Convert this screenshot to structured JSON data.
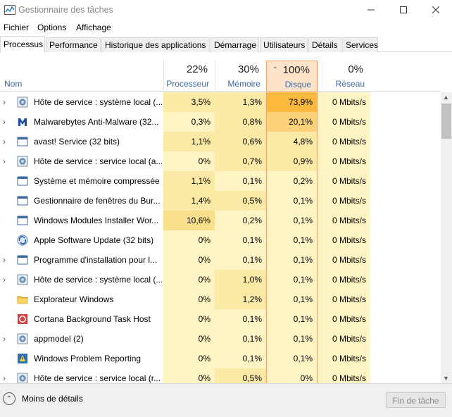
{
  "window": {
    "title": "Gestionnaire des tâches"
  },
  "menu": [
    "Fichier",
    "Options",
    "Affichage"
  ],
  "tabs": [
    "Processus",
    "Performance",
    "Historique des applications",
    "Démarrage",
    "Utilisateurs",
    "Détails",
    "Services"
  ],
  "columns": {
    "name": "Nom",
    "cpu": {
      "pct": "22%",
      "label": "Processeur"
    },
    "memory": {
      "pct": "30%",
      "label": "Mémoire"
    },
    "disk": {
      "pct": "100%",
      "label": "Disque"
    },
    "network": {
      "pct": "0%",
      "label": "Réseau"
    }
  },
  "sort_column": "disk",
  "colors": {
    "heat_light": "#fff4c4",
    "heat_mid": "#fbe9a6",
    "heat_strong": "#f9e08c",
    "heat_orange1": "#fcd27a",
    "heat_orange2": "#fbb93e",
    "sorted_border": "#f3a46c"
  },
  "processes": [
    {
      "name": "Hôte de service : système local (...",
      "cpu": "3,5%",
      "memory": "1,3%",
      "disk": "73,9%",
      "network": "0 Mbits/s",
      "expandable": true,
      "icon": "gear-icon"
    },
    {
      "name": "Malwarebytes Anti-Malware (32...",
      "cpu": "0,3%",
      "memory": "0,8%",
      "disk": "20,1%",
      "network": "0 Mbits/s",
      "expandable": true,
      "icon": "malwarebytes-icon"
    },
    {
      "name": "avast! Service (32 bits)",
      "cpu": "1,1%",
      "memory": "0,6%",
      "disk": "4,8%",
      "network": "0 Mbits/s",
      "expandable": true,
      "icon": "app-window-icon"
    },
    {
      "name": "Hôte de service : service local (a...",
      "cpu": "0%",
      "memory": "0,7%",
      "disk": "0,9%",
      "network": "0 Mbits/s",
      "expandable": true,
      "icon": "gear-icon"
    },
    {
      "name": "Système et mémoire compressée",
      "cpu": "1,1%",
      "memory": "0,1%",
      "disk": "0,2%",
      "network": "0 Mbits/s",
      "expandable": false,
      "icon": "app-window-icon"
    },
    {
      "name": "Gestionnaire de fenêtres du Bur...",
      "cpu": "1,4%",
      "memory": "0,5%",
      "disk": "0,1%",
      "network": "0 Mbits/s",
      "expandable": false,
      "icon": "app-window-icon"
    },
    {
      "name": "Windows Modules Installer Wor...",
      "cpu": "10,6%",
      "memory": "0,2%",
      "disk": "0,1%",
      "network": "0 Mbits/s",
      "expandable": false,
      "icon": "app-window-icon"
    },
    {
      "name": "Apple Software Update (32 bits)",
      "cpu": "0%",
      "memory": "0,1%",
      "disk": "0,1%",
      "network": "0 Mbits/s",
      "expandable": false,
      "icon": "apple-update-icon"
    },
    {
      "name": "Programme d'installation pour l...",
      "cpu": "0%",
      "memory": "0,1%",
      "disk": "0,1%",
      "network": "0 Mbits/s",
      "expandable": true,
      "icon": "app-window-icon"
    },
    {
      "name": "Hôte de service : système local (...",
      "cpu": "0%",
      "memory": "1,0%",
      "disk": "0,1%",
      "network": "0 Mbits/s",
      "expandable": true,
      "icon": "gear-icon"
    },
    {
      "name": "Explorateur Windows",
      "cpu": "0%",
      "memory": "1,2%",
      "disk": "0,1%",
      "network": "0 Mbits/s",
      "expandable": false,
      "icon": "folder-icon"
    },
    {
      "name": "Cortana Background Task Host",
      "cpu": "0%",
      "memory": "0,1%",
      "disk": "0,1%",
      "network": "0 Mbits/s",
      "expandable": false,
      "icon": "cortana-icon"
    },
    {
      "name": "appmodel (2)",
      "cpu": "0%",
      "memory": "0,1%",
      "disk": "0,1%",
      "network": "0 Mbits/s",
      "expandable": true,
      "icon": "gear-icon"
    },
    {
      "name": "Windows Problem Reporting",
      "cpu": "0%",
      "memory": "0,1%",
      "disk": "0,1%",
      "network": "0 Mbits/s",
      "expandable": false,
      "icon": "problem-reporting-icon"
    },
    {
      "name": "Hôte de service : service local (r...",
      "cpu": "0%",
      "memory": "0,5%",
      "disk": "0%",
      "network": "0 Mbits/s",
      "expandable": true,
      "icon": "gear-icon"
    }
  ],
  "footer": {
    "less_details": "Moins de détails",
    "end_task": "Fin de tâche"
  }
}
